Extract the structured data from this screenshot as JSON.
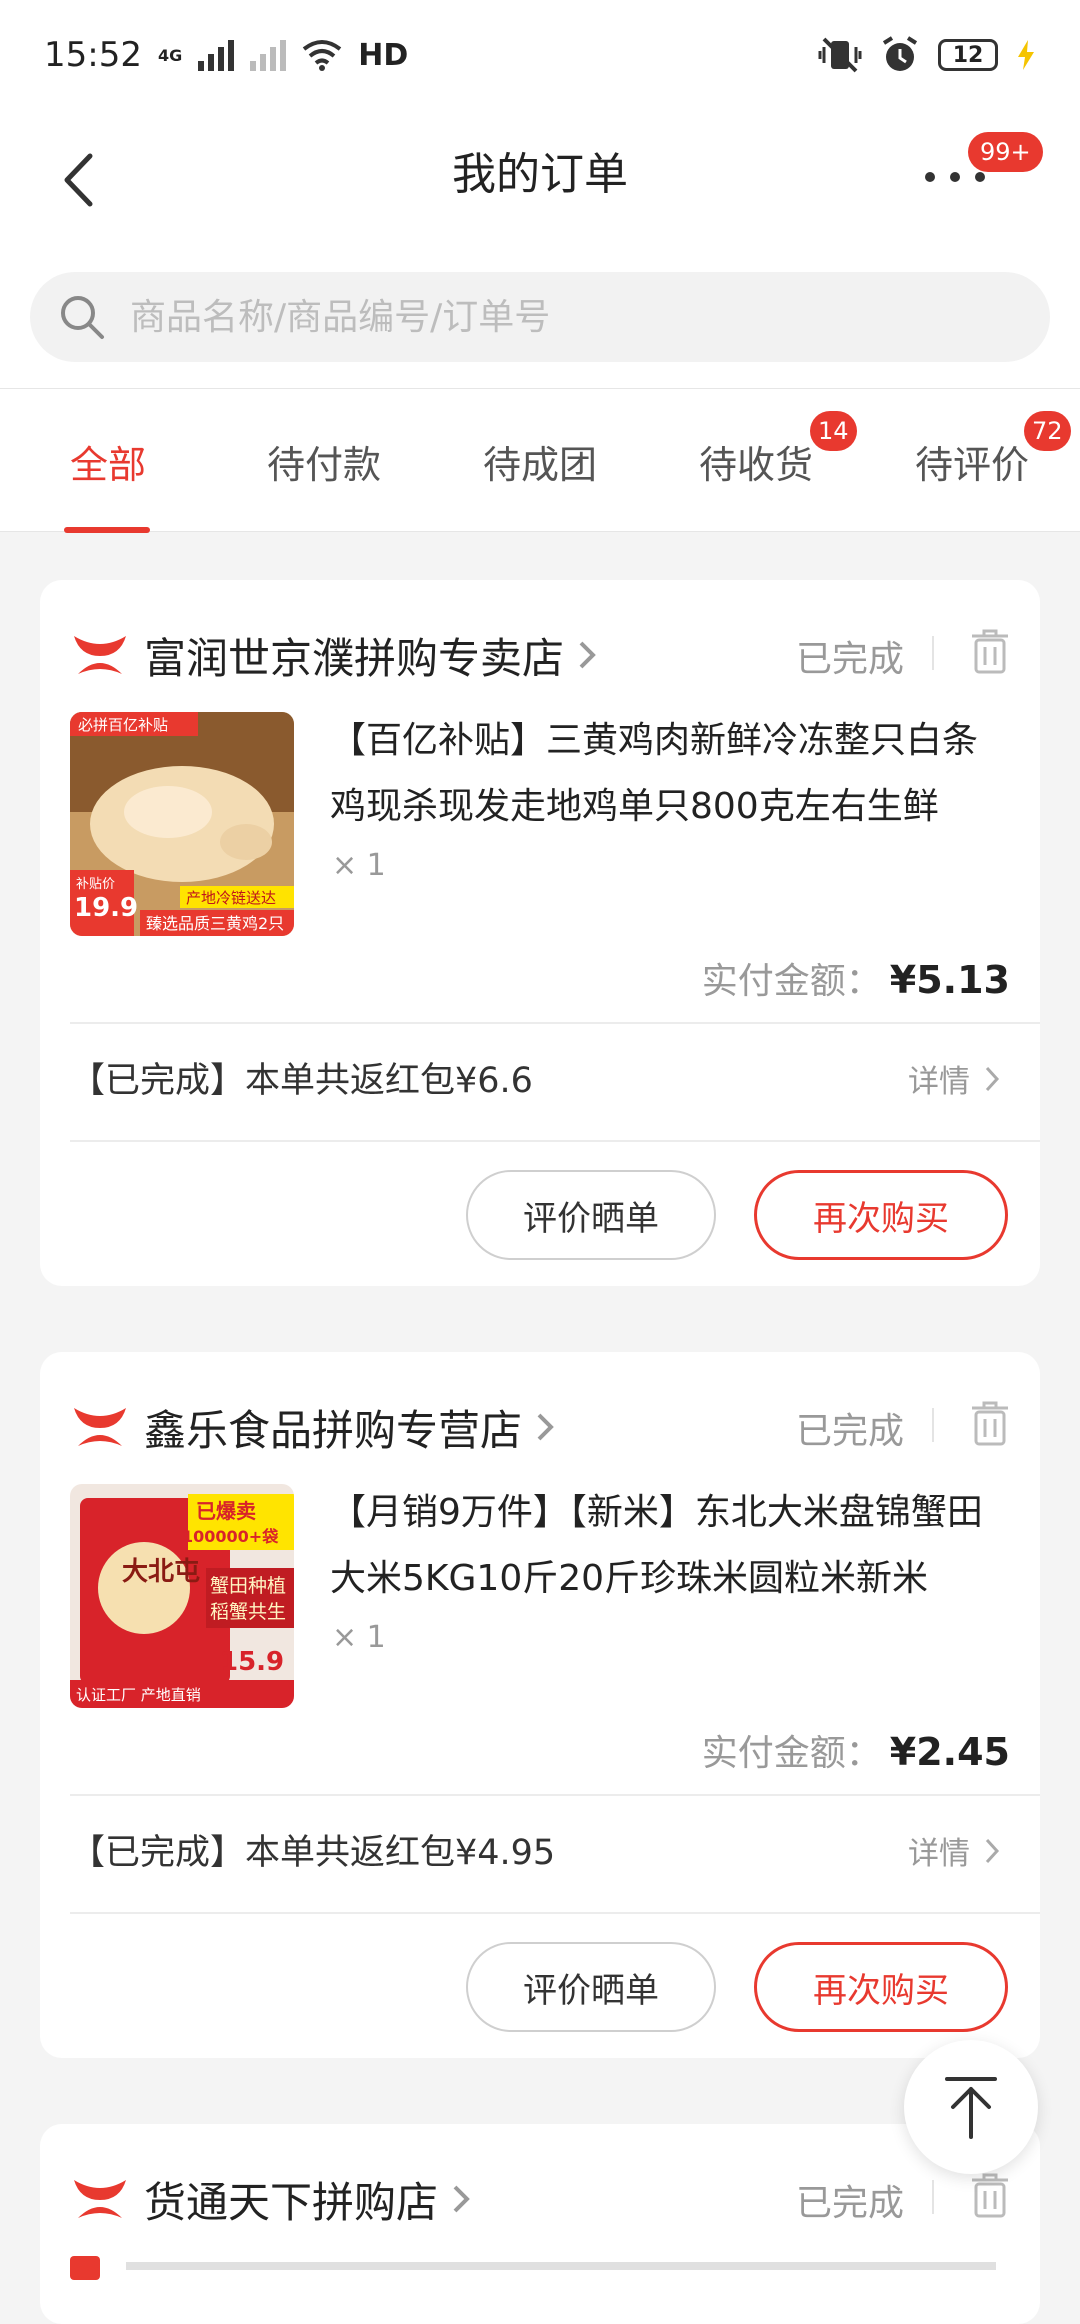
{
  "status_bar": {
    "time": "15:52",
    "network1": "4G",
    "network2": "HD",
    "battery": "12"
  },
  "header": {
    "title": "我的订单",
    "more_badge": "99+"
  },
  "search": {
    "placeholder": "商品名称/商品编号/订单号"
  },
  "tabs": [
    {
      "label": "全部",
      "badge": ""
    },
    {
      "label": "待付款",
      "badge": ""
    },
    {
      "label": "待成团",
      "badge": ""
    },
    {
      "label": "待收货",
      "badge": "14"
    },
    {
      "label": "待评价",
      "badge": "72"
    }
  ],
  "colors": {
    "accent": "#e8392f"
  },
  "orders": [
    {
      "shop": "富润世京濮拼购专卖店",
      "status": "已完成",
      "title": "【百亿补贴】三黄鸡肉新鲜冷冻整只白条鸡现杀现发走地鸡单只800克左右生鲜",
      "qty": "× 1",
      "paid_label": "实付金额：",
      "paid_amount": "¥5.13",
      "redpack": "【已完成】本单共返红包¥6.6",
      "detail": "详情",
      "btn_review": "评价晒单",
      "btn_rebuy": "再次购买",
      "image": {
        "badge": "必拼百亿补贴",
        "price_label": "补贴价",
        "price": "19.9",
        "tag1": "产地冷链送达",
        "tag2": "臻选品质三黄鸡2只"
      }
    },
    {
      "shop": "鑫乐食品拼购专营店",
      "status": "已完成",
      "title": "【月销9万件】【新米】东北大米盘锦蟹田大米5KG10斤20斤珍珠米圆粒米新米",
      "qty": "× 1",
      "paid_label": "实付金额：",
      "paid_amount": "¥2.45",
      "redpack": "【已完成】本单共返红包¥4.95",
      "detail": "详情",
      "btn_review": "评价晒单",
      "btn_rebuy": "再次购买",
      "image": {
        "tag_top": "已爆卖",
        "tag_count": "100000+袋",
        "brand": "大北屯",
        "tag1": "蟹田种植",
        "tag2": "稻蟹共生",
        "price": "15.9",
        "footer": "认证工厂 产地直销"
      }
    },
    {
      "shop": "货通天下拼购店",
      "status": "已完成"
    }
  ]
}
